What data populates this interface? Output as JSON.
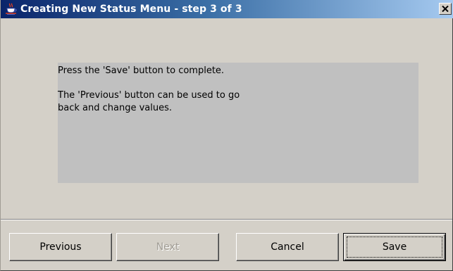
{
  "window": {
    "title": "Creating New Status Menu - step 3 of 3",
    "icon": "java-cup-icon",
    "close_icon": "close-icon"
  },
  "message": {
    "line1": "Press the 'Save' button to complete.",
    "line2": "The 'Previous' button can be used to go",
    "line3": "back and change values."
  },
  "buttons": {
    "previous": "Previous",
    "next": "Next",
    "cancel": "Cancel",
    "save": "Save"
  },
  "colors": {
    "titlebar_start": "#0a246a",
    "titlebar_end": "#a6caf0",
    "panel": "#c0c0c0",
    "window_bg": "#d4d0c8"
  }
}
